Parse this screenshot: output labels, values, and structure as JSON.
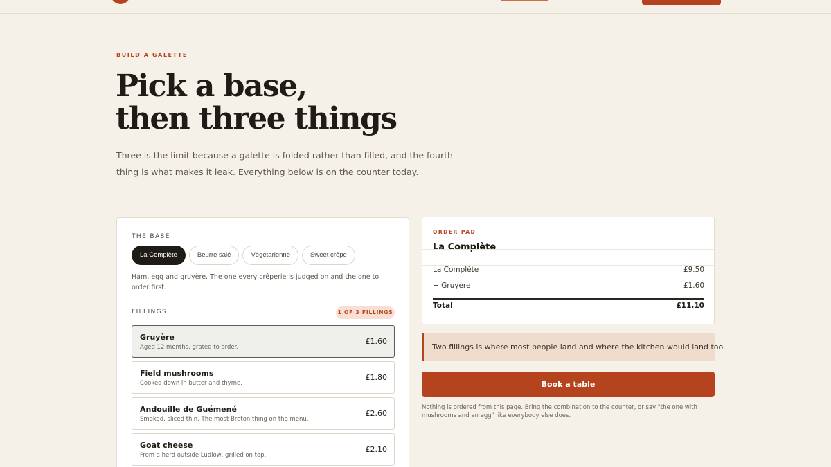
{
  "colors": {
    "accent": "#b5441e",
    "background": "#f5f1e8",
    "ink": "#1f1b16",
    "note_bg": "#f0dccd",
    "badge_bg": "#f7dfd3"
  },
  "hero": {
    "eyebrow": "BUILD A GALETTE",
    "headline_line1": "Pick a base,",
    "headline_line2": "then three things",
    "lede": "Three is the limit because a galette is folded rather than filled, and the fourth thing is what makes it leak. Everything below is on the counter today."
  },
  "builder": {
    "base_label": "THE BASE",
    "bases": [
      {
        "label": "La Complète",
        "active": true
      },
      {
        "label": "Beurre salé",
        "active": false
      },
      {
        "label": "Végétarienne",
        "active": false
      },
      {
        "label": "Sweet crêpe",
        "active": false
      }
    ],
    "base_description": "Ham, egg and gruyère. The one every crêperie is judged on and the one to order first.",
    "fillings_label": "FILLINGS",
    "fillings_count": "1 OF 3 FILLINGS",
    "fillings": [
      {
        "name": "Gruyère",
        "desc": "Aged 12 months, grated to order.",
        "price": "£1.60",
        "selected": true
      },
      {
        "name": "Field mushrooms",
        "desc": "Cooked down in butter and thyme.",
        "price": "£1.80",
        "selected": false
      },
      {
        "name": "Andouille de Guémené",
        "desc": "Smoked, sliced thin. The most Breton thing on the menu.",
        "price": "£2.60",
        "selected": false
      },
      {
        "name": "Goat cheese",
        "desc": "From a herd outside Ludlow, grilled on top.",
        "price": "£2.10",
        "selected": false
      }
    ]
  },
  "order_pad": {
    "eyebrow": "ORDER PAD",
    "title": "La Complète",
    "lines": [
      {
        "label": "La Complète",
        "amount": "£9.50"
      },
      {
        "label": "+ Gruyère",
        "amount": "£1.60"
      }
    ],
    "total_label": "Total",
    "total_amount": "£11.10"
  },
  "note": "Two fillings is where most people land and where the kitchen would land too.",
  "book_button": "Book a table",
  "fineprint": "Nothing is ordered from this page. Bring the combination to the counter, or say \"the one with mushrooms and an egg\" like everybody else does."
}
